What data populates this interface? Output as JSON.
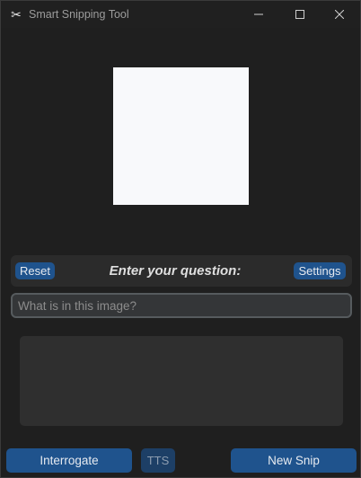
{
  "window": {
    "title": "Smart Snipping Tool",
    "app_icon": "scissors-icon",
    "controls": {
      "minimize_icon": "minimize-icon",
      "maximize_icon": "maximize-icon",
      "close_icon": "close-icon"
    }
  },
  "preview": {
    "background": "#f8f9fb"
  },
  "question_bar": {
    "reset_label": "Reset",
    "prompt_label": "Enter your question:",
    "settings_label": "Settings"
  },
  "question_input": {
    "value": "",
    "placeholder": "What is in this image?"
  },
  "answer": {
    "text": ""
  },
  "actions": {
    "interrogate_label": "Interrogate",
    "tts_label": "TTS",
    "new_snip_label": "New Snip"
  },
  "colors": {
    "window_bg": "#1f1f1f",
    "accent": "#1f538d",
    "accent_disabled": "#1d3f66",
    "panel": "#2b2b2b"
  }
}
